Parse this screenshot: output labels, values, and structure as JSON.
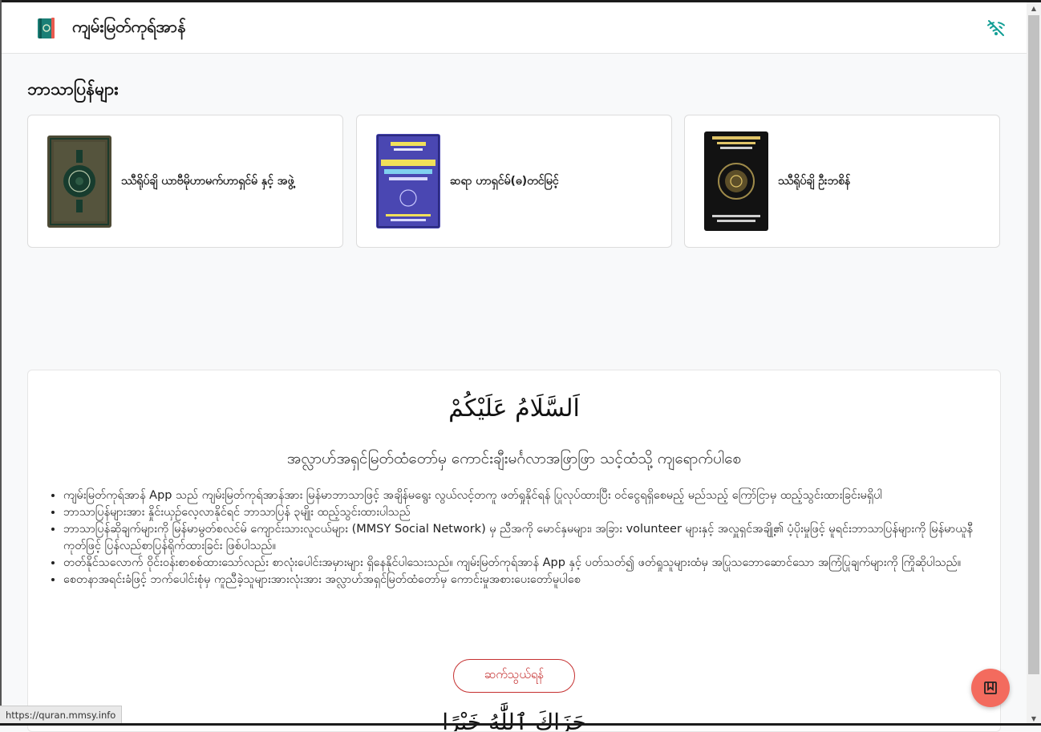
{
  "app": {
    "title": "ကျမ်းမြတ်ကုရ်အာန်",
    "icon": "quran-book-icon",
    "offline_icon": "wifi-off-icon",
    "accent": "#129e95"
  },
  "translations": {
    "heading": "ဘာသာပြန်များ",
    "items": [
      {
        "label": "ဿီရိုပ်ချိ ယာဗီမိုဟာမက်ဟာရှင်မ် နှင့် အဖွဲ့"
      },
      {
        "label": "ဆရာ ဟာရှင်မ်(ဓ)တင်မြင့်"
      },
      {
        "label": "ဿီရိုပ်ချိ ဦးဘစိန်"
      }
    ]
  },
  "intro": {
    "arabic_greeting": "اَلسَّلَامُ عَلَيْكُمْ",
    "blessing": "အလ္လာဟ်အရှင်မြတ်ထံတော်မှ ကောင်းချီးမင်္ဂလာအဖြာဖြာ သင့်ထံသို့ ကျရောက်ပါစေ",
    "points": [
      "ကျမ်းမြတ်ကုရ်အာန် App သည် ကျမ်းမြတ်ကုရ်အာန်အား မြန်မာဘာသာဖြင့် အချိန်မရွေး လွယ်လင့်တကူ ဖတ်ရှုနိုင်ရန် ပြုလုပ်ထားပြီး ဝင်ငွေရရှိစေမည့် မည်သည့် ကြော်ငြာမှ ထည့်သွင်းထားခြင်းမရှိပါ",
      "ဘာသာပြန်များအား နှိုင်းယှဉ်လေ့လာနိုင်ရင် ဘာသာပြန် ၃မျိုး ထည့်သွင်းထားပါသည်",
      "ဘာသာပြန်ဆိုချက်များကို မြန်မာမွတ်စလင်မ် ကျောင်းသားလူငယ်များ (MMSY Social Network) မှ ညီအကို မောင်နှမများ၊ အခြား volunteer များနှင့် အလှူရှင်အချို့၏ ပံ့ပိုးမှုဖြင့် မူရင်းဘာသာပြန်များကို မြန်မာယူနီကုတ်ဖြင့် ပြန်လည်စာပြန်ရိုက်ထားခြင်း ဖြစ်ပါသည်။",
      "တတ်နိုင်သလောက် ဝိုင်းဝန်းစာစစ်ထားသော်လည်း စာလုံးပေါင်းအမှားများ ရှိနေနိုင်ပါသေးသည်။ ကျမ်းမြတ်ကုရ်အာန် App နှင့် ပတ်သတ်၍ ဖတ်ရှုသူများထံမှ အပြုသဘောဆောင်သော အကြံပြုချက်များကို ကြိုဆိုပါသည်။",
      "စေတနာအရင်းခံဖြင့် ဘက်ပေါင်းစုံမှ ကူညီခဲ့သူများအားလုံးအား အလ္လာဟ်အရှင်မြတ်ထံတော်မှ ကောင်းမှုအစားပေးတော်မူပါစေ"
    ],
    "contact_button": "ဆက်သွယ်ရန်",
    "arabic_footer": "جَزَاكَ ٱللَّٰهُ خَيْرًا"
  },
  "fab": {
    "icon": "bookmark-icon",
    "color": "#f36b5e"
  },
  "statusbar": {
    "url": "https://quran.mmsy.info"
  }
}
